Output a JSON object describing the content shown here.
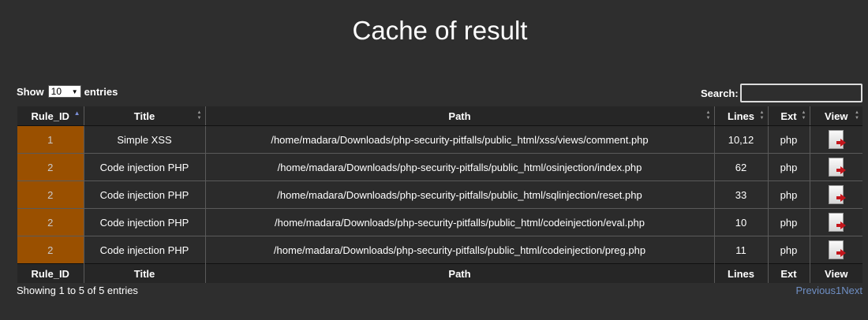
{
  "page": {
    "title": "Cache of result"
  },
  "controls": {
    "show_label": "Show",
    "length_value": "10",
    "entries_label": "entries",
    "search_label": "Search:",
    "search_value": ""
  },
  "table": {
    "columns": [
      "Rule_ID",
      "Title",
      "Path",
      "Lines",
      "Ext",
      "View"
    ],
    "rows": [
      {
        "rule_id": "1",
        "title": "Simple XSS",
        "path": "/home/madara/Downloads/php-security-pitfalls/public_html/xss/views/comment.php",
        "lines": "10,12",
        "ext": "php"
      },
      {
        "rule_id": "2",
        "title": "Code injection PHP",
        "path": "/home/madara/Downloads/php-security-pitfalls/public_html/osinjection/index.php",
        "lines": "62",
        "ext": "php"
      },
      {
        "rule_id": "2",
        "title": "Code injection PHP",
        "path": "/home/madara/Downloads/php-security-pitfalls/public_html/sqlinjection/reset.php",
        "lines": "33",
        "ext": "php"
      },
      {
        "rule_id": "2",
        "title": "Code injection PHP",
        "path": "/home/madara/Downloads/php-security-pitfalls/public_html/codeinjection/eval.php",
        "lines": "10",
        "ext": "php"
      },
      {
        "rule_id": "2",
        "title": "Code injection PHP",
        "path": "/home/madara/Downloads/php-security-pitfalls/public_html/codeinjection/preg.php",
        "lines": "11",
        "ext": "php"
      }
    ],
    "sorted_column": "Rule_ID",
    "sort_direction": "ascending",
    "view_icon": "document-view-icon"
  },
  "footer": {
    "info": "Showing 1 to 5 of 5 entries",
    "previous": "Previous",
    "current_page": "1",
    "next": "Next"
  },
  "colors": {
    "background": "#2e2e2e",
    "sorted_column_bg": "#9a5000",
    "link": "#6f8fc4"
  }
}
